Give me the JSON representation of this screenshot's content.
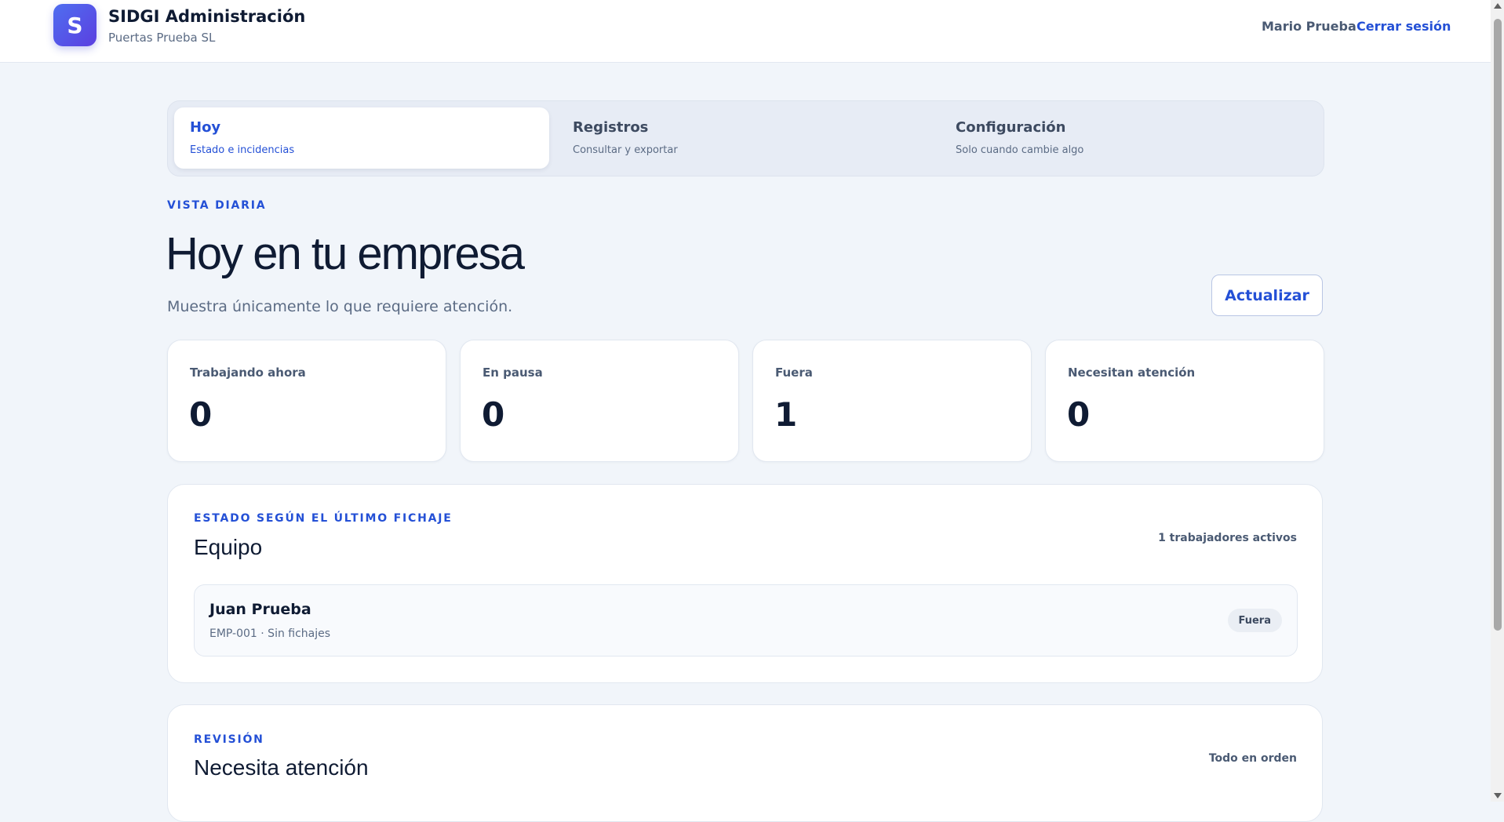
{
  "app": {
    "logo_letter": "S",
    "title": "SIDGI Administración",
    "company": "Puertas Prueba SL"
  },
  "user": {
    "name": "Mario Prueba",
    "logout_label": "Cerrar sesión"
  },
  "tabs": [
    {
      "label": "Hoy",
      "subtitle": "Estado e incidencias",
      "active": true
    },
    {
      "label": "Registros",
      "subtitle": "Consultar y exportar",
      "active": false
    },
    {
      "label": "Configuración",
      "subtitle": "Solo cuando cambie algo",
      "active": false
    }
  ],
  "page": {
    "eyebrow": "VISTA DIARIA",
    "title": "Hoy en tu empresa",
    "description": "Muestra únicamente lo que requiere atención.",
    "refresh_label": "Actualizar"
  },
  "stats": [
    {
      "label": "Trabajando ahora",
      "value": "0"
    },
    {
      "label": "En pausa",
      "value": "0"
    },
    {
      "label": "Fuera",
      "value": "1"
    },
    {
      "label": "Necesitan atención",
      "value": "0"
    }
  ],
  "team": {
    "eyebrow": "ESTADO SEGÚN EL ÚLTIMO FICHAJE",
    "title": "Equipo",
    "count_text": "1 trabajadores activos",
    "employees": [
      {
        "name": "Juan Prueba",
        "meta": "EMP-001 · Sin fichajes",
        "status": "Fuera"
      }
    ]
  },
  "review": {
    "eyebrow": "REVISIÓN",
    "title": "Necesita atención",
    "status_text": "Todo en orden"
  },
  "colors": {
    "accent": "#2450d6",
    "background": "#f1f5fa",
    "text": "#0f1b33",
    "muted": "#5b6b84"
  }
}
